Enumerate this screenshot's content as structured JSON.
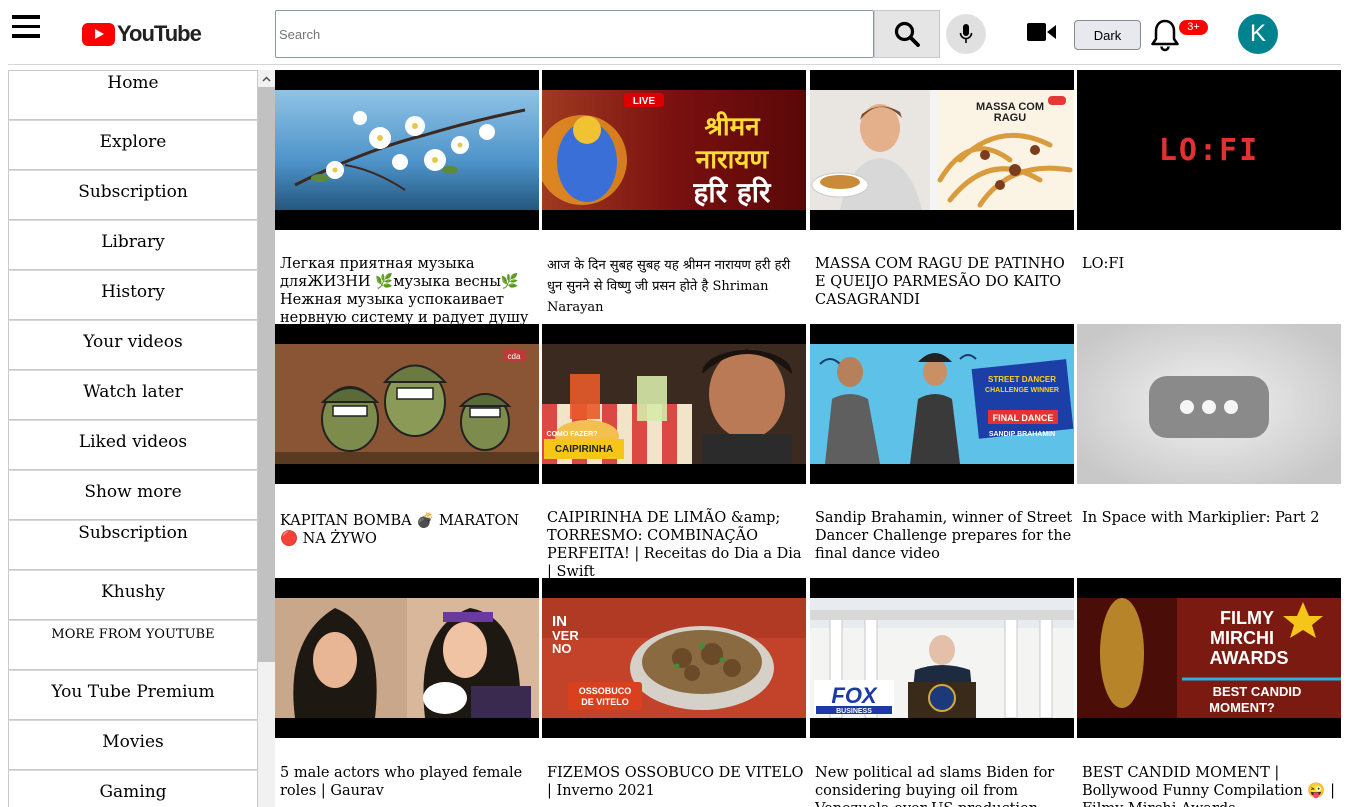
{
  "header": {
    "logo_text": "YouTube",
    "search_placeholder": "Search",
    "dark_label": "Dark",
    "notification_count": "3+",
    "avatar_letter": "K",
    "colors": {
      "brand_red": "#ff0000",
      "avatar_bg": "#00838f"
    }
  },
  "sidebar": {
    "items": [
      {
        "label": "Home"
      },
      {
        "label": "Explore"
      },
      {
        "label": "Subscription"
      },
      {
        "label": "Library"
      },
      {
        "label": "History"
      },
      {
        "label": "Your videos"
      },
      {
        "label": "Watch later"
      },
      {
        "label": "Liked videos"
      },
      {
        "label": "Show more"
      },
      {
        "label": "Subscription"
      },
      {
        "label": "Khushy"
      },
      {
        "label": "MORE FROM YOUTUBE"
      },
      {
        "label": "You Tube Premium"
      },
      {
        "label": "Movies"
      },
      {
        "label": "Gaming"
      }
    ]
  },
  "videos": [
    {
      "title": "Легкая приятная музыка дляЖИЗНИ 🌿музыка весны🌿Нежная музыка успокаивает нервную систему и радует душу"
    },
    {
      "title": "आज के दिन सुबह सुबह यह श्रीमन नारायण हरी हरी धुन सुनने से विष्णु जी प्रसन होते है Shriman Narayan"
    },
    {
      "title": "MASSA COM RAGU DE PATINHO E QUEIJO PARMESÃO DO KAITO CASAGRANDI"
    },
    {
      "title": "LO:FI",
      "thumb_text": "LO:FI"
    },
    {
      "title": "KAPITAN BOMBA 💣 MARATON 🔴 NA ŻYWO"
    },
    {
      "title": "CAIPIRINHA DE LIMÃO &amp; TORRESMO: COMBINAÇÃO PERFEITA! | Receitas do Dia a Dia | Swift"
    },
    {
      "title": "Sandip Brahamin, winner of Street Dancer Challenge prepares for the final dance video"
    },
    {
      "title": "In Space with Markiplier: Part 2"
    },
    {
      "title": "5 male actors who played female roles | Gaurav"
    },
    {
      "title": "FIZEMOS OSSOBUCO DE VITELO | Inverno 2021"
    },
    {
      "title": "New political ad slams Biden for considering buying oil from Venezuela over US production"
    },
    {
      "title": "BEST CANDID MOMENT | Bollywood Funny Compilation 😜 | Filmy Mirchi Awards"
    }
  ]
}
